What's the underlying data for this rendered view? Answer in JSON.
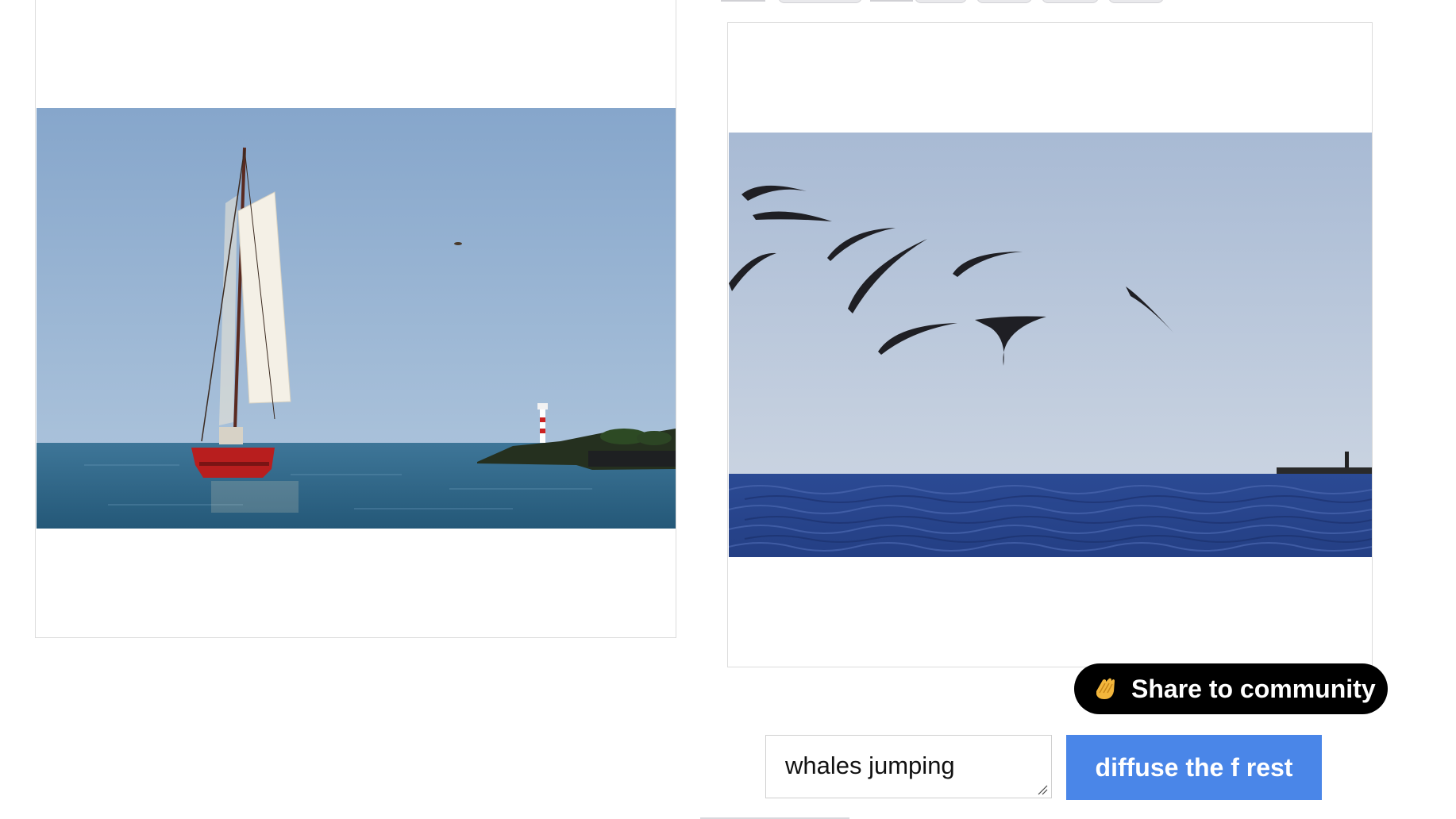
{
  "share_button": {
    "label": "Share to community",
    "icon": "hands-clapping-icon"
  },
  "prompt": {
    "value": "whales jumping"
  },
  "submit_button": {
    "label": "diffuse the f rest"
  },
  "input_image": {
    "subject": "sailboat"
  },
  "output_image": {
    "subject": "whales"
  },
  "colors": {
    "submit_bg": "#4a86e8",
    "share_bg": "#000000",
    "sky_left": "#8aa9cc",
    "sea_left": "#2e6589",
    "sky_right": "#aebfd8",
    "sea_right": "#27478e"
  }
}
